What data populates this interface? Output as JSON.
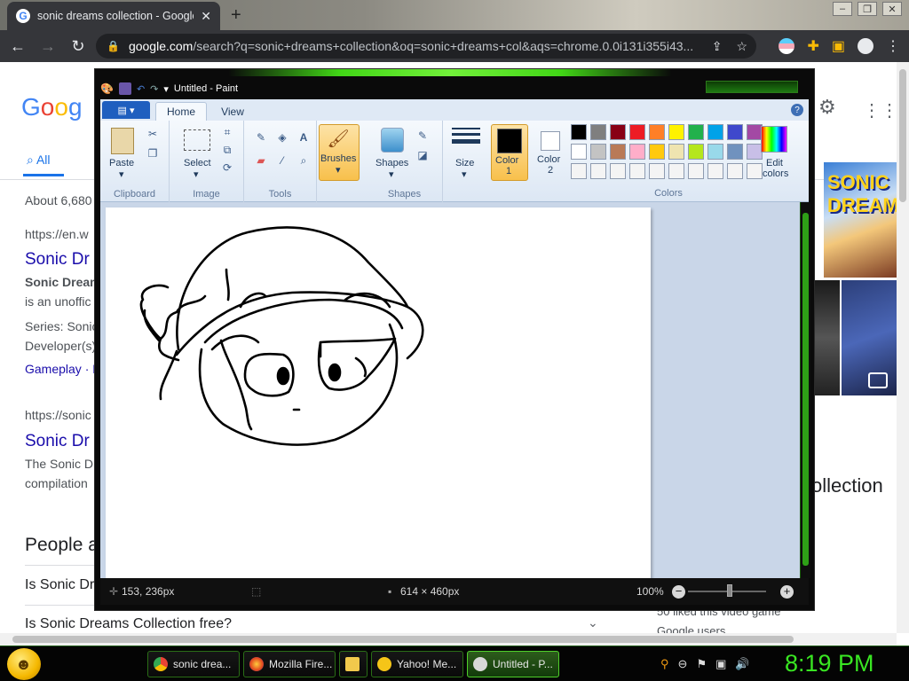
{
  "browser": {
    "tab_title": "sonic dreams collection - Google",
    "tab_close": "✕",
    "new_tab": "+",
    "url_host": "google.com",
    "url_rest": "/search?q=sonic+dreams+collection&oq=sonic+dreams+col&aqs=chrome.0.0i131i355i43..."
  },
  "google": {
    "logo": [
      "G",
      "o",
      "o",
      "g"
    ],
    "tab_all": "All",
    "about": "About 6,680",
    "results": [
      {
        "url": "https://en.w",
        "title": "Sonic Dr",
        "snippet1": "Sonic Dream",
        "snippet2": "is an unoffic",
        "series": "Series: Sonic",
        "developer": "Developer(s)",
        "gameplay": "Gameplay · D"
      },
      {
        "url": "https://sonic",
        "title": "Sonic Dr",
        "snippet1": "The Sonic D",
        "snippet2": "compilation"
      }
    ],
    "people_also": "People a",
    "questions": [
      "Is Sonic Dr",
      "Is Sonic Dreams Collection free?"
    ],
    "right_title": "ollection",
    "right_tile_text": "SONIC DREAMS",
    "footer_partial": "50 liked this video game",
    "footer_partial2": "Google users"
  },
  "paint": {
    "title": "Untitled - Paint",
    "file_menu": "▤ ▾",
    "tabs": [
      "Home",
      "View"
    ],
    "groups": {
      "clipboard": "Clipboard",
      "image": "Image",
      "tools": "Tools",
      "shapes": "Shapes",
      "colors": "Colors"
    },
    "buttons": {
      "paste": "Paste",
      "select": "Select",
      "brushes": "Brushes",
      "shapes": "Shapes",
      "size": "Size",
      "color1_a": "Color",
      "color1_b": "1",
      "color2_a": "Color",
      "color2_b": "2",
      "edit_colors_a": "Edit",
      "edit_colors_b": "colors"
    },
    "palette_row1": [
      "#000000",
      "#7f7f7f",
      "#880015",
      "#ed1c24",
      "#ff7f27",
      "#fff200",
      "#22b14c",
      "#00a2e8",
      "#3f48cc",
      "#a349a4"
    ],
    "palette_row2": [
      "#ffffff",
      "#c3c3c3",
      "#b97a57",
      "#ffaec9",
      "#ffc90e",
      "#efe4b0",
      "#b5e61d",
      "#99d9ea",
      "#7092be",
      "#c8bfe7"
    ],
    "status": {
      "cursor": "153, 236px",
      "size": "614 × 460px",
      "zoom": "100%"
    }
  },
  "taskbar": {
    "items": [
      "sonic drea...",
      "Mozilla Fire...",
      "",
      "Yahoo! Me...",
      "Untitled - P..."
    ],
    "clock": "8:19 PM"
  },
  "colors": {
    "chrome_dark": "#35363a",
    "google_link": "#1a0dab",
    "accent_green": "#39e622"
  }
}
